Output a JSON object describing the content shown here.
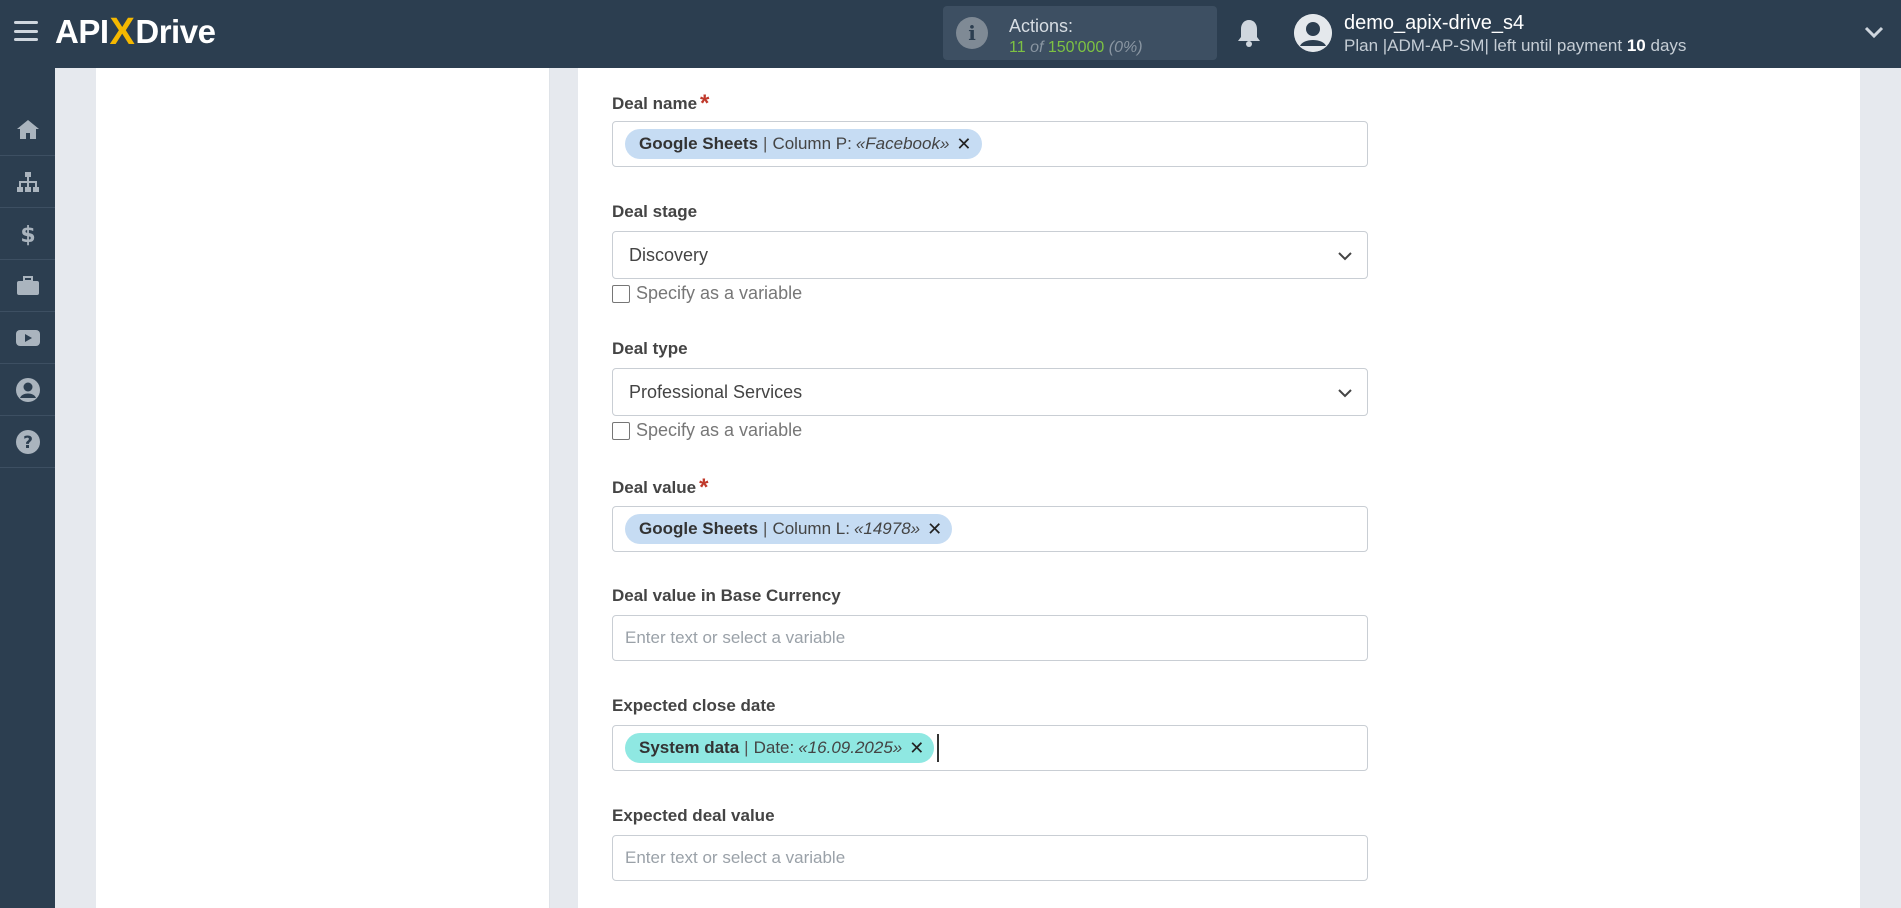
{
  "header": {
    "logo_left": "API",
    "logo_x": "X",
    "logo_right": "Drive",
    "actions_title": "Actions:",
    "actions_used": "11",
    "actions_of": "of",
    "actions_total": "150'000",
    "actions_percent": "(0%)",
    "username": "demo_apix-drive_s4",
    "plan_prefix": "Plan |ADM-AP-SM| left until payment",
    "plan_days": "10",
    "plan_suffix": "days"
  },
  "sidebar": {
    "items": [
      "home-icon",
      "sitemap-icon",
      "dollar-icon",
      "briefcase-icon",
      "youtube-icon",
      "user-circle-icon",
      "question-circle-icon"
    ]
  },
  "form": {
    "deal_name": {
      "label": "Deal name",
      "required_mark": "*",
      "tag": {
        "source": "Google Sheets",
        "sep": "|",
        "field": "Column P:",
        "value": "«Facebook»",
        "remove": "✕"
      }
    },
    "deal_stage": {
      "label": "Deal stage",
      "selected": "Discovery",
      "checkbox_label": "Specify as a variable"
    },
    "deal_type": {
      "label": "Deal type",
      "selected": "Professional Services",
      "checkbox_label": "Specify as a variable"
    },
    "deal_value": {
      "label": "Deal value",
      "required_mark": "*",
      "tag": {
        "source": "Google Sheets",
        "sep": "|",
        "field": "Column L:",
        "value": "«14978»",
        "remove": "✕"
      }
    },
    "deal_value_base": {
      "label": "Deal value in Base Currency",
      "placeholder": "Enter text or select a variable"
    },
    "expected_close_date": {
      "label": "Expected close date",
      "tag": {
        "source": "System data",
        "sep": "|",
        "field": "Date:",
        "value": "«16.09.2025»",
        "remove": "✕"
      }
    },
    "expected_deal_value": {
      "label": "Expected deal value",
      "placeholder": "Enter text or select a variable"
    }
  },
  "colors": {
    "topbar": "#2c3e50",
    "accent_green": "#7dc242",
    "logo_yellow": "#f5b800",
    "tag_blue": "#c6dcf3",
    "tag_teal": "#8fe8e2",
    "required_red": "#c0392b"
  }
}
